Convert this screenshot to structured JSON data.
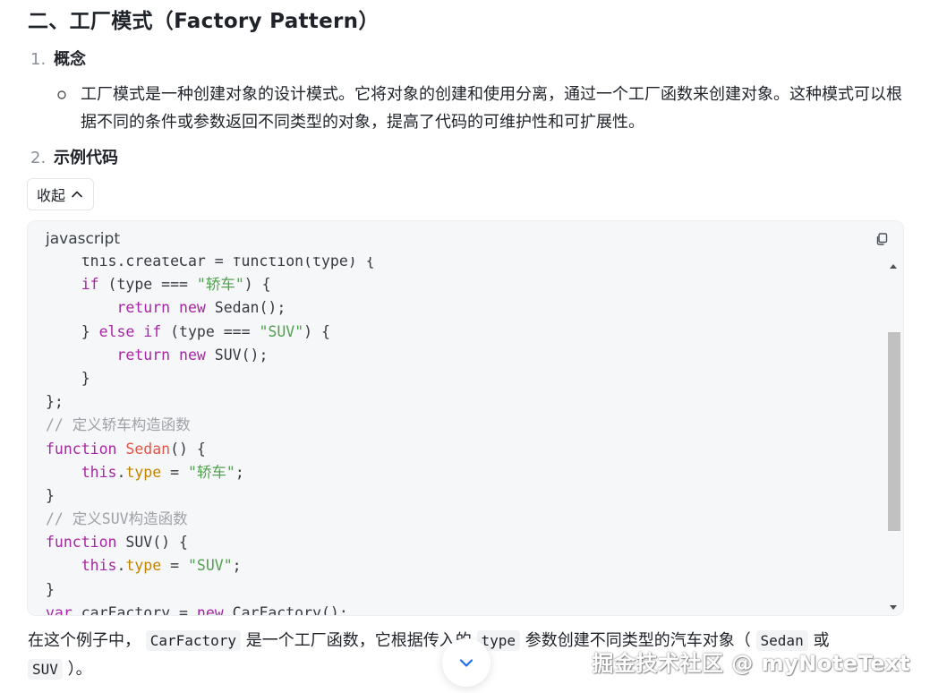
{
  "heading": "二、工厂模式（Factory Pattern）",
  "list": [
    {
      "num": "1.",
      "label": "概念"
    },
    {
      "num": "2.",
      "label": "示例代码"
    }
  ],
  "concept_text": "工厂模式是一种创建对象的设计模式。它将对象的创建和使用分离，通过一个工厂函数来创建对象。这种模式可以根据不同的条件或参数返回不同类型的对象，提高了代码的可维护性和可扩展性。",
  "collapse_label": "收起",
  "code": {
    "language": "javascript",
    "lines": [
      [
        {
          "t": "    this.createCar = function(type) {",
          "c": "cut"
        }
      ],
      [
        {
          "t": "    "
        },
        {
          "t": "if",
          "c": "kw"
        },
        {
          "t": " (type === "
        },
        {
          "t": "\"轿车\"",
          "c": "str"
        },
        {
          "t": ") {"
        }
      ],
      [
        {
          "t": "        "
        },
        {
          "t": "return",
          "c": "kw"
        },
        {
          "t": " "
        },
        {
          "t": "new",
          "c": "kw"
        },
        {
          "t": " Sedan();"
        }
      ],
      [
        {
          "t": "    } "
        },
        {
          "t": "else",
          "c": "kw"
        },
        {
          "t": " "
        },
        {
          "t": "if",
          "c": "kw"
        },
        {
          "t": " (type === "
        },
        {
          "t": "\"SUV\"",
          "c": "str"
        },
        {
          "t": ") {"
        }
      ],
      [
        {
          "t": "        "
        },
        {
          "t": "return",
          "c": "kw"
        },
        {
          "t": " "
        },
        {
          "t": "new",
          "c": "kw"
        },
        {
          "t": " SUV();"
        }
      ],
      [
        {
          "t": "    }"
        }
      ],
      [
        {
          "t": "};"
        }
      ],
      [
        {
          "t": "// 定义轿车构造函数",
          "c": "cmt"
        }
      ],
      [
        {
          "t": "function",
          "c": "kw"
        },
        {
          "t": " "
        },
        {
          "t": "Sedan",
          "c": "fn"
        },
        {
          "t": "() {"
        }
      ],
      [
        {
          "t": "    "
        },
        {
          "t": "this",
          "c": "kw"
        },
        {
          "t": "."
        },
        {
          "t": "type",
          "c": "prop"
        },
        {
          "t": " = "
        },
        {
          "t": "\"轿车\"",
          "c": "str"
        },
        {
          "t": ";"
        }
      ],
      [
        {
          "t": "}"
        }
      ],
      [
        {
          "t": "// 定义SUV构造函数",
          "c": "cmt"
        }
      ],
      [
        {
          "t": "function",
          "c": "kw"
        },
        {
          "t": " SUV() {"
        }
      ],
      [
        {
          "t": "    "
        },
        {
          "t": "this",
          "c": "kw"
        },
        {
          "t": "."
        },
        {
          "t": "type",
          "c": "prop"
        },
        {
          "t": " = "
        },
        {
          "t": "\"SUV\"",
          "c": "str"
        },
        {
          "t": ";"
        }
      ],
      [
        {
          "t": "}"
        }
      ],
      [
        {
          "t": "var",
          "c": "kw"
        },
        {
          "t": " carFactory = "
        },
        {
          "t": "new",
          "c": "kw"
        },
        {
          "t": " CarFactory();"
        }
      ]
    ]
  },
  "bottom_text": {
    "p1": "在这个例子中，",
    "code1": "CarFactory",
    "p2": "是一个工厂函数，它根据传入的",
    "code2": "type",
    "p3": "参数创建不同类型的汽车对象（",
    "code3": "Sedan",
    "p4": "或",
    "code4": "SUV",
    "p5": "）。"
  },
  "watermark": "掘金技术社区 @ myNoteText",
  "colors": {
    "keyword": "#a626a4",
    "string": "#50a14f",
    "function_name": "#e45649",
    "property": "#c18401",
    "comment": "#a0a1a7",
    "scroll_arrow": "#1e6fe8"
  },
  "icons": {
    "collapse": "chevron-up-icon",
    "copy": "copy-icon",
    "scroll_down": "chevron-down-icon"
  }
}
